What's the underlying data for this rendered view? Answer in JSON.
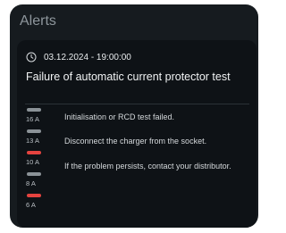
{
  "panel": {
    "title": "Alerts"
  },
  "alert": {
    "icon": "clock-icon",
    "timestamp": "03.12.2024 - 19:00:00",
    "title": "Failure of automatic current protector test",
    "messages": [
      "Initialisation or RCD test failed.",
      "Disconnect the charger from the socket.",
      "If the problem persists, contact your distributor."
    ]
  },
  "current_levels": [
    {
      "label": "16 A",
      "status": "normal"
    },
    {
      "label": "13 A",
      "status": "normal"
    },
    {
      "label": "10 A",
      "status": "fault"
    },
    {
      "label": "8 A",
      "status": "normal"
    },
    {
      "label": "6 A",
      "status": "fault"
    }
  ],
  "colors": {
    "panel_bg": "#161b1f",
    "card_bg": "#0e1216",
    "level_normal": "#8b9297",
    "level_fault": "#e4433f"
  }
}
